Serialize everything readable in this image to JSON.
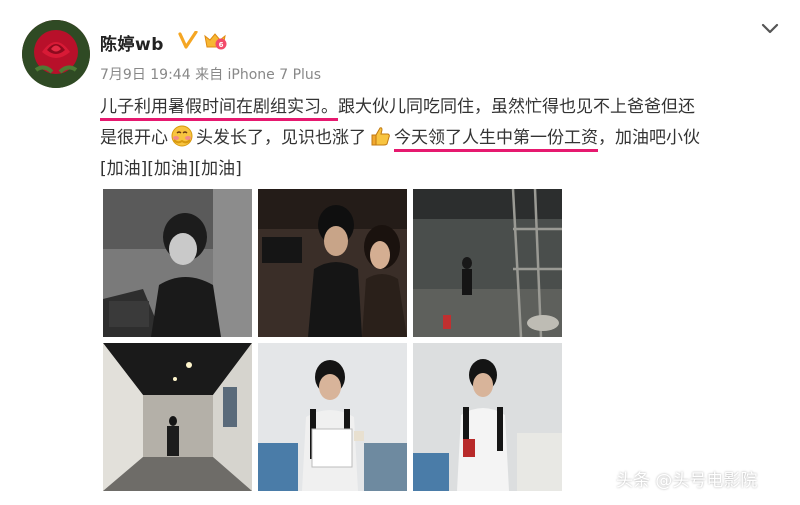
{
  "post": {
    "username": "陈婷wb",
    "timestamp": "7月9日 19:44",
    "source_prefix": "来自",
    "device": "iPhone 7 Plus",
    "lines": [
      {
        "h1": "儿子利用暑假时间在剧组实习。",
        "t1": "跟大伙儿同吃同住，虽然忙得也见不上爸爸但还"
      },
      {
        "t1": "是很开心",
        "t2": "头发长了，见识也涨了",
        "h1": "今天领了人生中第一份工资",
        "t3": "，加油吧小伙"
      },
      {
        "t1": "[加油][加油][加油]"
      }
    ],
    "highlight_color": "#e6196f"
  },
  "icons": {
    "avatar": "red-rose",
    "verified": "verified-v-icon",
    "vip": "vip-badge-icon",
    "menu": "chevron-down-icon",
    "emoji_1": "blush-face-emoji",
    "emoji_2": "thumbs-up-emoji"
  },
  "photos": [
    {
      "name": "photo-1",
      "tone": "grayscale"
    },
    {
      "name": "photo-2",
      "tone": "dark"
    },
    {
      "name": "photo-3",
      "tone": "dark"
    },
    {
      "name": "photo-4",
      "tone": "corridor"
    },
    {
      "name": "photo-5",
      "tone": "bright"
    },
    {
      "name": "photo-6",
      "tone": "bright"
    }
  ],
  "watermark": "头条 @头号电影院"
}
